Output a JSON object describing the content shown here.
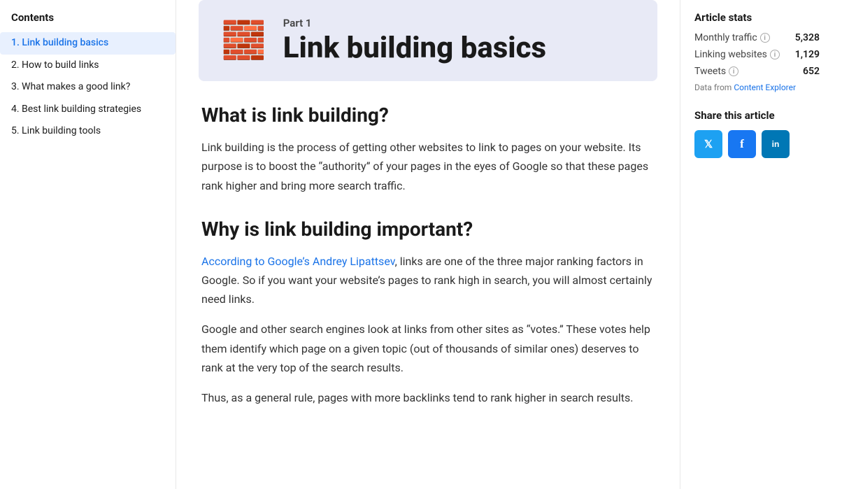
{
  "sidebar": {
    "title": "Contents",
    "items": [
      {
        "id": "item-1",
        "label": "1. Link building basics",
        "active": true
      },
      {
        "id": "item-2",
        "label": "2. How to build links",
        "active": false
      },
      {
        "id": "item-3",
        "label": "3. What makes a good link?",
        "active": false
      },
      {
        "id": "item-4",
        "label": "4. Best link building strategies",
        "active": false
      },
      {
        "id": "item-5",
        "label": "5. Link building tools",
        "active": false
      }
    ]
  },
  "hero": {
    "part_label": "Part 1",
    "title": "Link building basics",
    "icon": "🧱"
  },
  "article": {
    "sections": [
      {
        "heading": "What is link building?",
        "paragraphs": [
          "Link building is the process of getting other websites to link to pages on your website. Its purpose is to boost the “authority” of your pages in the eyes of Google so that these pages rank higher and bring more search traffic."
        ]
      },
      {
        "heading": "Why is link building important?",
        "paragraphs": [
          {
            "parts": [
              {
                "type": "link",
                "text": "According to Google’s Andrey Lipattsev",
                "href": "#"
              },
              {
                "type": "text",
                "text": ", links are one of the three major ranking factors in Google. So if you want your website’s pages to rank high in search, you will almost certainly need links."
              }
            ]
          },
          "Google and other search engines look at links from other sites as “votes.” These votes help them identify which page on a given topic (out of thousands of similar ones) deserves to rank at the very top of the search results.",
          "Thus, as a general rule, pages with more backlinks tend to rank higher in search results."
        ]
      }
    ]
  },
  "stats": {
    "title": "Article stats",
    "monthly_traffic_label": "Monthly traffic",
    "monthly_traffic_value": "5,328",
    "linking_websites_label": "Linking websites",
    "linking_websites_value": "1,129",
    "tweets_label": "Tweets",
    "tweets_value": "652",
    "data_source_prefix": "Data from",
    "data_source_link_text": "Content Explorer",
    "info_icon": "i"
  },
  "share": {
    "title": "Share this article",
    "twitter_label": "Twitter",
    "facebook_label": "Facebook",
    "linkedin_label": "LinkedIn"
  },
  "colors": {
    "twitter": "#1da1f2",
    "facebook": "#1877f2",
    "linkedin": "#0077b5"
  }
}
